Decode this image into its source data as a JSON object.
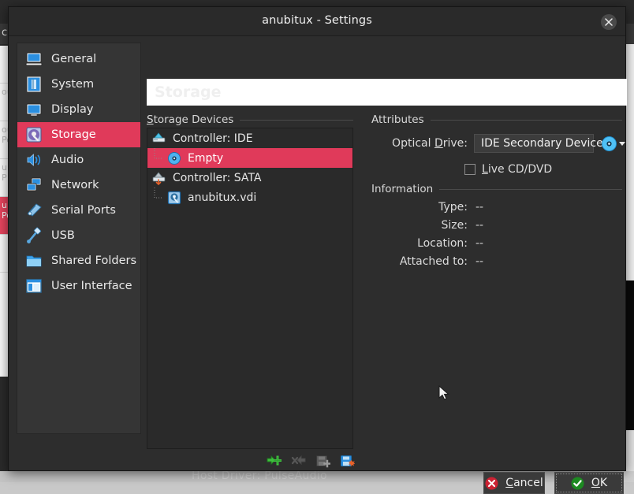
{
  "background": {
    "toolbar_text": "ch",
    "status_text": "Host Driver:  PulseAudio",
    "vm_rows": [
      {
        "label": "",
        "selected": false
      },
      {
        "label": "ou",
        "selected": false
      },
      {
        "label": "ou\nPo",
        "selected": false
      },
      {
        "label": "u\nP",
        "selected": false
      },
      {
        "label": "ub\nPo",
        "selected": true
      },
      {
        "label": "",
        "selected": false
      }
    ]
  },
  "dialog": {
    "title": "anubitux - Settings",
    "close_icon": "close-icon",
    "page_title": "Storage"
  },
  "sidebar": {
    "items": [
      {
        "label": "General",
        "icon": "general-icon",
        "selected": false
      },
      {
        "label": "System",
        "icon": "system-icon",
        "selected": false
      },
      {
        "label": "Display",
        "icon": "display-icon",
        "selected": false
      },
      {
        "label": "Storage",
        "icon": "storage-icon",
        "selected": true
      },
      {
        "label": "Audio",
        "icon": "audio-icon",
        "selected": false
      },
      {
        "label": "Network",
        "icon": "network-icon",
        "selected": false
      },
      {
        "label": "Serial Ports",
        "icon": "serial-ports-icon",
        "selected": false
      },
      {
        "label": "USB",
        "icon": "usb-icon",
        "selected": false
      },
      {
        "label": "Shared Folders",
        "icon": "shared-folders-icon",
        "selected": false
      },
      {
        "label": "User Interface",
        "icon": "user-interface-icon",
        "selected": false
      }
    ]
  },
  "storage_devices": {
    "caption_pre": "S",
    "caption_accel": "t",
    "caption_post": "orage Devices",
    "tree": [
      {
        "label": "Controller: IDE",
        "icon": "ide-controller-icon",
        "level": 0,
        "selected": false
      },
      {
        "label": "Empty",
        "icon": "optical-disc-icon",
        "level": 1,
        "selected": true
      },
      {
        "label": "Controller: SATA",
        "icon": "sata-controller-icon",
        "level": 0,
        "selected": false
      },
      {
        "label": "anubitux.vdi",
        "icon": "hard-disk-icon",
        "level": 1,
        "selected": false
      }
    ],
    "toolbar": [
      {
        "name": "add-controller-button",
        "icon": "add-controller-icon",
        "enabled": true
      },
      {
        "name": "remove-controller-button",
        "icon": "remove-controller-icon",
        "enabled": false
      },
      {
        "name": "add-attachment-button",
        "icon": "add-attachment-icon",
        "enabled": true
      },
      {
        "name": "remove-attachment-button",
        "icon": "remove-attachment-icon",
        "enabled": true
      }
    ]
  },
  "attributes": {
    "caption": "Attributes",
    "optical_drive": {
      "label_pre": "Optical ",
      "label_accel": "D",
      "label_post": "rive:",
      "value": "IDE Secondary Device",
      "disc_icon": "optical-disc-icon"
    },
    "live_cd": {
      "label_accel": "L",
      "label_post": "ive CD/DVD",
      "checked": false
    }
  },
  "information": {
    "caption": "Information",
    "rows": [
      {
        "label": "Type:",
        "value": "--"
      },
      {
        "label": "Size:",
        "value": "--"
      },
      {
        "label": "Location:",
        "value": "--"
      },
      {
        "label": "Attached to:",
        "value": "--"
      }
    ]
  },
  "footer": {
    "cancel": {
      "accel": "C",
      "rest": "ancel",
      "icon": "cancel-icon"
    },
    "ok": {
      "accel": "O",
      "rest": "K",
      "icon": "ok-icon"
    }
  },
  "colors": {
    "accent_selection": "#e03a5a",
    "dialog_bg": "#2d2d2d",
    "sidebar_bg": "#353535",
    "cancel_red": "#cc2233",
    "ok_green": "#1d8a21"
  }
}
